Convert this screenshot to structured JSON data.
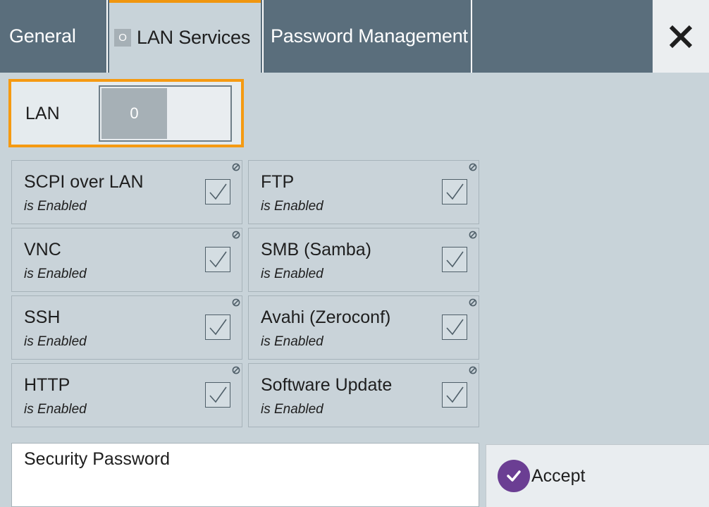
{
  "tabs": [
    {
      "label": "General",
      "active": false
    },
    {
      "label": "LAN Services",
      "active": true,
      "badge": "O"
    },
    {
      "label": "Password Management",
      "active": false
    }
  ],
  "close_icon": "close-icon",
  "lan": {
    "label": "LAN",
    "toggle_state": "0"
  },
  "services": [
    {
      "name": "SCPI over LAN",
      "state": "is Enabled",
      "checked": true
    },
    {
      "name": "FTP",
      "state": "is Enabled",
      "checked": true
    },
    {
      "name": "VNC",
      "state": "is Enabled",
      "checked": true
    },
    {
      "name": "SMB (Samba)",
      "state": "is Enabled",
      "checked": true
    },
    {
      "name": "SSH",
      "state": "is Enabled",
      "checked": true
    },
    {
      "name": "Avahi (Zeroconf)",
      "state": "is Enabled",
      "checked": true
    },
    {
      "name": "HTTP",
      "state": "is Enabled",
      "checked": true
    },
    {
      "name": "Software Update",
      "state": "is Enabled",
      "checked": true
    }
  ],
  "security_password": {
    "label": "Security Password",
    "value": ""
  },
  "accept": {
    "label": "Accept",
    "icon": "check-circle-icon"
  },
  "colors": {
    "accent": "#f59a12",
    "tabbar": "#5a6e7c",
    "accept_icon": "#6b3e93",
    "panel": "#c8d3d9"
  }
}
